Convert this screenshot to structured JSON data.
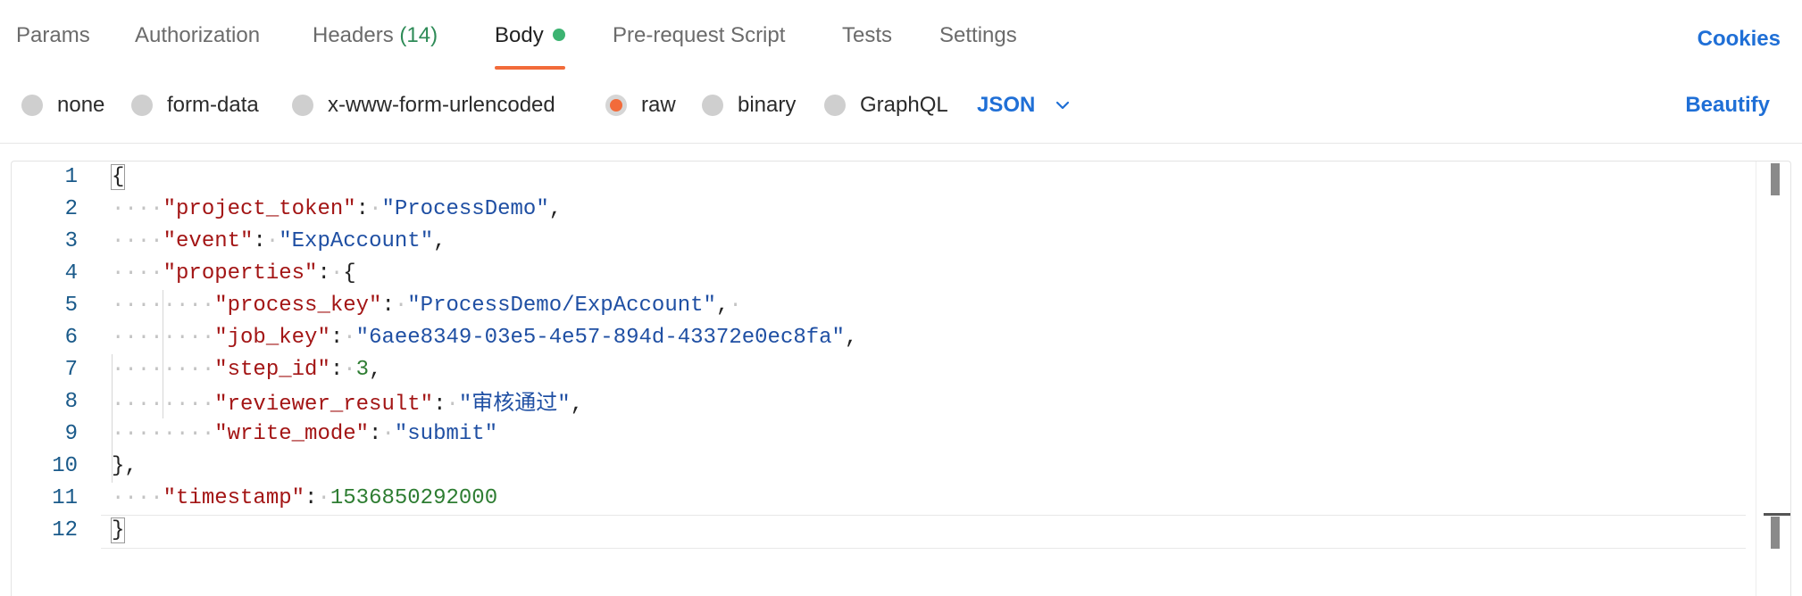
{
  "tabs": [
    {
      "label": "Params"
    },
    {
      "label": "Authorization"
    },
    {
      "label": "Headers",
      "count": "(14)"
    },
    {
      "label": "Body"
    },
    {
      "label": "Pre-request Script"
    },
    {
      "label": "Tests"
    },
    {
      "label": "Settings"
    }
  ],
  "cookies_label": "Cookies",
  "body_types": [
    {
      "label": "none"
    },
    {
      "label": "form-data"
    },
    {
      "label": "x-www-form-urlencoded"
    },
    {
      "label": "raw",
      "selected": true
    },
    {
      "label": "binary"
    },
    {
      "label": "GraphQL"
    }
  ],
  "language": "JSON",
  "beautify_label": "Beautify",
  "editor": {
    "line_numbers": [
      "1",
      "2",
      "3",
      "4",
      "5",
      "6",
      "7",
      "8",
      "9",
      "10",
      "11",
      "12"
    ],
    "json_values": {
      "project_token": "ProcessDemo",
      "event": "ExpAccount",
      "process_key": "ProcessDemo/ExpAccount",
      "job_key": "6aee8349-03e5-4e57-894d-43372e0ec8fa",
      "step_id": 3,
      "reviewer_result": "审核通过",
      "write_mode": "submit",
      "timestamp": 1536850292000
    }
  },
  "colors": {
    "accent": "#f26b3a",
    "link": "#1f6fd6",
    "status_dot": "#3cb371"
  }
}
